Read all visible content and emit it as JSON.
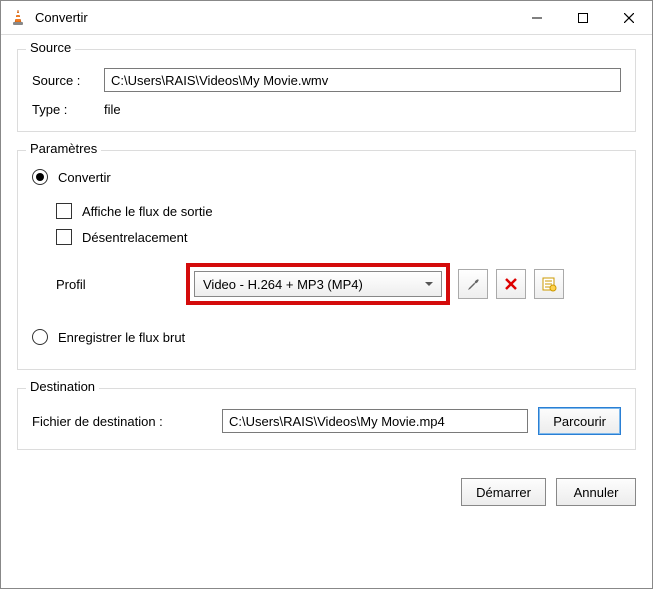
{
  "window": {
    "title": "Convertir"
  },
  "source": {
    "group_title": "Source",
    "source_label": "Source :",
    "source_value": "C:\\Users\\RAIS\\Videos\\My Movie.wmv",
    "type_label": "Type :",
    "type_value": "file"
  },
  "params": {
    "group_title": "Paramètres",
    "convert_label": "Convertir",
    "show_output_label": "Affiche le flux de sortie",
    "deinterlace_label": "Désentrelacement",
    "profile_label": "Profil",
    "profile_value": "Video - H.264 + MP3 (MP4)",
    "dump_raw_label": "Enregistrer le flux brut"
  },
  "destination": {
    "group_title": "Destination",
    "dest_label": "Fichier de destination :",
    "dest_value": "C:\\Users\\RAIS\\Videos\\My Movie.mp4",
    "browse_label": "Parcourir"
  },
  "footer": {
    "start_label": "Démarrer",
    "cancel_label": "Annuler"
  }
}
